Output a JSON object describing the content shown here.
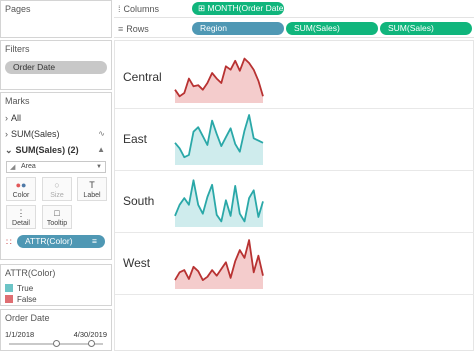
{
  "cards": {
    "pages": "Pages",
    "filters": "Filters",
    "marks": "Marks",
    "legend_title": "ATTR(Color)",
    "date_title": "Order Date"
  },
  "filters": {
    "pill": "Order Date"
  },
  "marks": {
    "all": "All",
    "sum1": "SUM(Sales)",
    "sum2": "SUM(Sales) (2)",
    "mark_type": "Area",
    "buttons": [
      "Color",
      "Size",
      "Label",
      "Detail",
      "Tooltip"
    ],
    "color_pill": "ATTR(Color)"
  },
  "legend": [
    {
      "label": "True",
      "color": "#6cc4c6"
    },
    {
      "label": "False",
      "color": "#df6e72"
    }
  ],
  "date_filter": {
    "start": "1/1/2018",
    "end": "4/30/2019"
  },
  "shelves": {
    "columns_label": "Columns",
    "columns_pills": [
      "MONTH(Order Date)"
    ],
    "rows_label": "Rows",
    "rows_pills": [
      "Region",
      "SUM(Sales)",
      "SUM(Sales)"
    ]
  },
  "colors": {
    "true_line": "#2aa8a8",
    "true_fill": "#cfeced",
    "false_line": "#b83232",
    "false_fill": "#f4cccc",
    "pill_green": "#10b57c",
    "pill_blue": "#4f98b4"
  },
  "chart_data": {
    "type": "area",
    "series": [
      {
        "name": "Central",
        "color": "False",
        "values": [
          12,
          6,
          9,
          22,
          15,
          16,
          12,
          18,
          27,
          22,
          18,
          33,
          30,
          38,
          29,
          40,
          36,
          30,
          20,
          6
        ]
      },
      {
        "name": "East",
        "color": "True",
        "values": [
          20,
          15,
          7,
          9,
          30,
          34,
          26,
          18,
          40,
          28,
          17,
          25,
          33,
          19,
          12,
          31,
          45,
          24,
          22,
          20
        ]
      },
      {
        "name": "South",
        "color": "True",
        "values": [
          10,
          20,
          26,
          20,
          42,
          20,
          12,
          27,
          38,
          11,
          5,
          24,
          10,
          37,
          12,
          5,
          26,
          33,
          9,
          23
        ]
      },
      {
        "name": "West",
        "color": "False",
        "values": [
          8,
          15,
          17,
          9,
          20,
          16,
          8,
          11,
          17,
          12,
          18,
          24,
          10,
          25,
          35,
          28,
          44,
          15,
          30,
          12
        ]
      }
    ]
  }
}
